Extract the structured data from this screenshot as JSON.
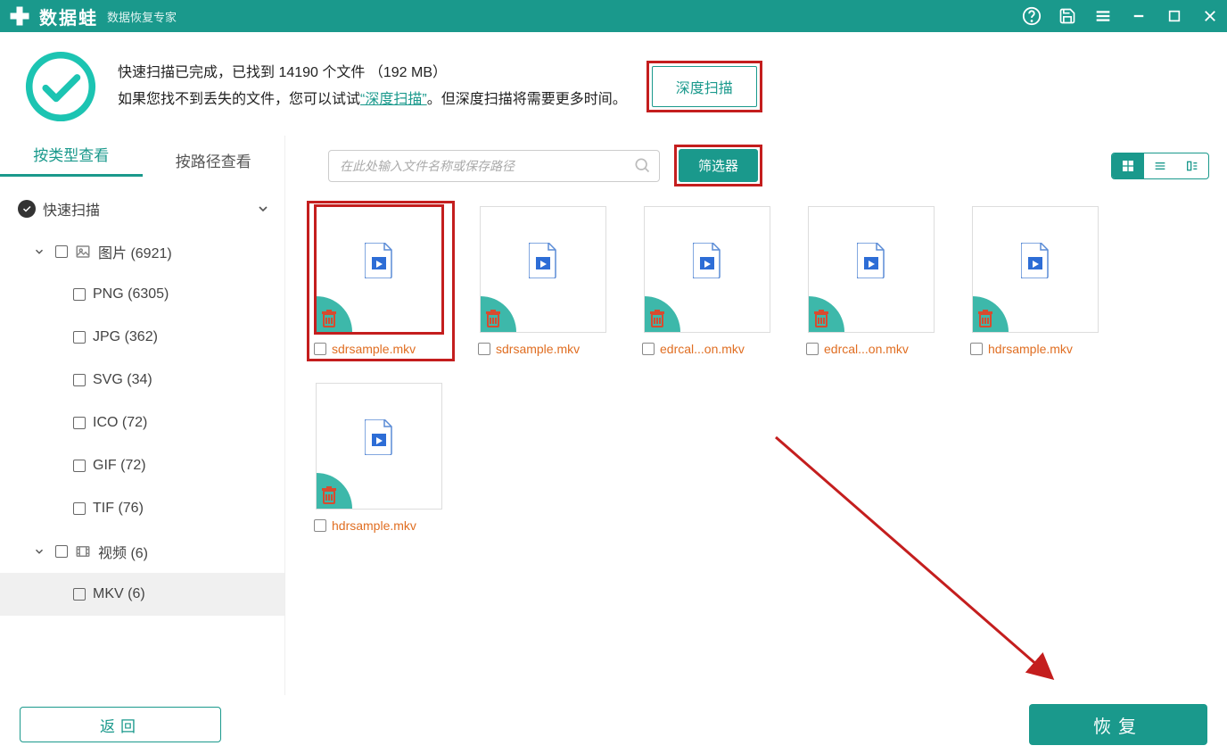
{
  "titlebar": {
    "app_name": "数据蛙",
    "tagline": "数据恢复专家"
  },
  "header": {
    "line1_prefix": "快速扫描已完成，已找到 ",
    "file_count": "14190",
    "line1_mid": " 个文件 （",
    "size": "192 MB",
    "line1_suffix": "）",
    "line2_prefix": "如果您找不到丢失的文件，您可以试试",
    "deep_link": "“深度扫描”",
    "line2_suffix": "。但深度扫描将需要更多时间。",
    "deep_button": "深度扫描"
  },
  "tabs": {
    "by_type": "按类型查看",
    "by_path": "按路径查看"
  },
  "tree": {
    "quick_scan": "快速扫描",
    "images": "图片 (6921)",
    "png": "PNG (6305)",
    "jpg": "JPG (362)",
    "svg": "SVG (34)",
    "ico": "ICO (72)",
    "gif": "GIF (72)",
    "tif": "TIF (76)",
    "videos": "视频 (6)",
    "mkv": "MKV (6)"
  },
  "toolbar": {
    "search_placeholder": "在此处输入文件名称或保存路径",
    "filter": "筛选器"
  },
  "files": [
    {
      "name": "sdrsample.mkv",
      "highlight": true
    },
    {
      "name": "sdrsample.mkv",
      "highlight": false
    },
    {
      "name": "edrcal...on.mkv",
      "highlight": false
    },
    {
      "name": "edrcal...on.mkv",
      "highlight": false
    },
    {
      "name": "hdrsample.mkv",
      "highlight": false
    },
    {
      "name": "hdrsample.mkv",
      "highlight": false
    }
  ],
  "footer": {
    "back": "返回",
    "recover": "恢复"
  }
}
